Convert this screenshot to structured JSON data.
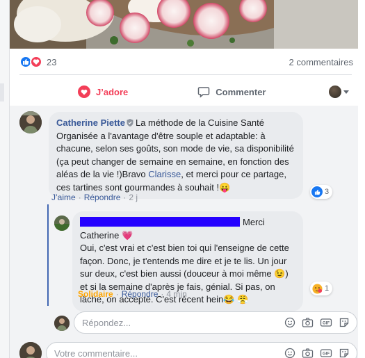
{
  "post": {
    "reaction_count": "23",
    "comments_count": "2 commentaires"
  },
  "actions": {
    "love_label": "J’adore",
    "comment_label": "Commenter"
  },
  "comment1": {
    "author": "Catherine Piette",
    "text_part1": "La méthode de la Cuisine Santé Organisée a l'avantage d'être souple et adaptable: à chacune, selon ses goûts, son mode de vie, sa disponibilité (ça peut changer de semaine en semaine, en fonction des aléas de la vie !)Bravo",
    "mention": "Clarisse",
    "text_part2": ", et merci pour ce partage, ces tartines sont gourmandes à souhait !",
    "emoji": "😛",
    "like_label": "J’aime",
    "reply_label": "Répondre",
    "time": "2 j",
    "reaction_count": "3"
  },
  "reply1": {
    "text_part1": "Merci Catherine",
    "emoji1": "💗",
    "text_part2": "Oui, c'est vrai et c'est bien toi qui l'enseigne de cette façon. Donc, je t'entends me dire et je te lis. Un jour sur deux, c'est bien aussi (douceur à moi même",
    "emoji2": "😉",
    "text_part3": ") et si la semaine d'après je fais, génial. Si pas, on lâche, on accepte. C'est récent hein",
    "emoji3": "😂",
    "emoji4": "😤",
    "badge_label": "Solidaire",
    "reply_label": "Répondre",
    "time": "4 min",
    "reaction_count": "1"
  },
  "reply_input": {
    "placeholder": "Répondez..."
  },
  "comment_input": {
    "placeholder": "Votre commentaire..."
  },
  "colors": {
    "link": "#385898",
    "love": "#f33e58",
    "like": "#1877f2",
    "badge": "#ffa500",
    "redaction": "#2500ff"
  }
}
